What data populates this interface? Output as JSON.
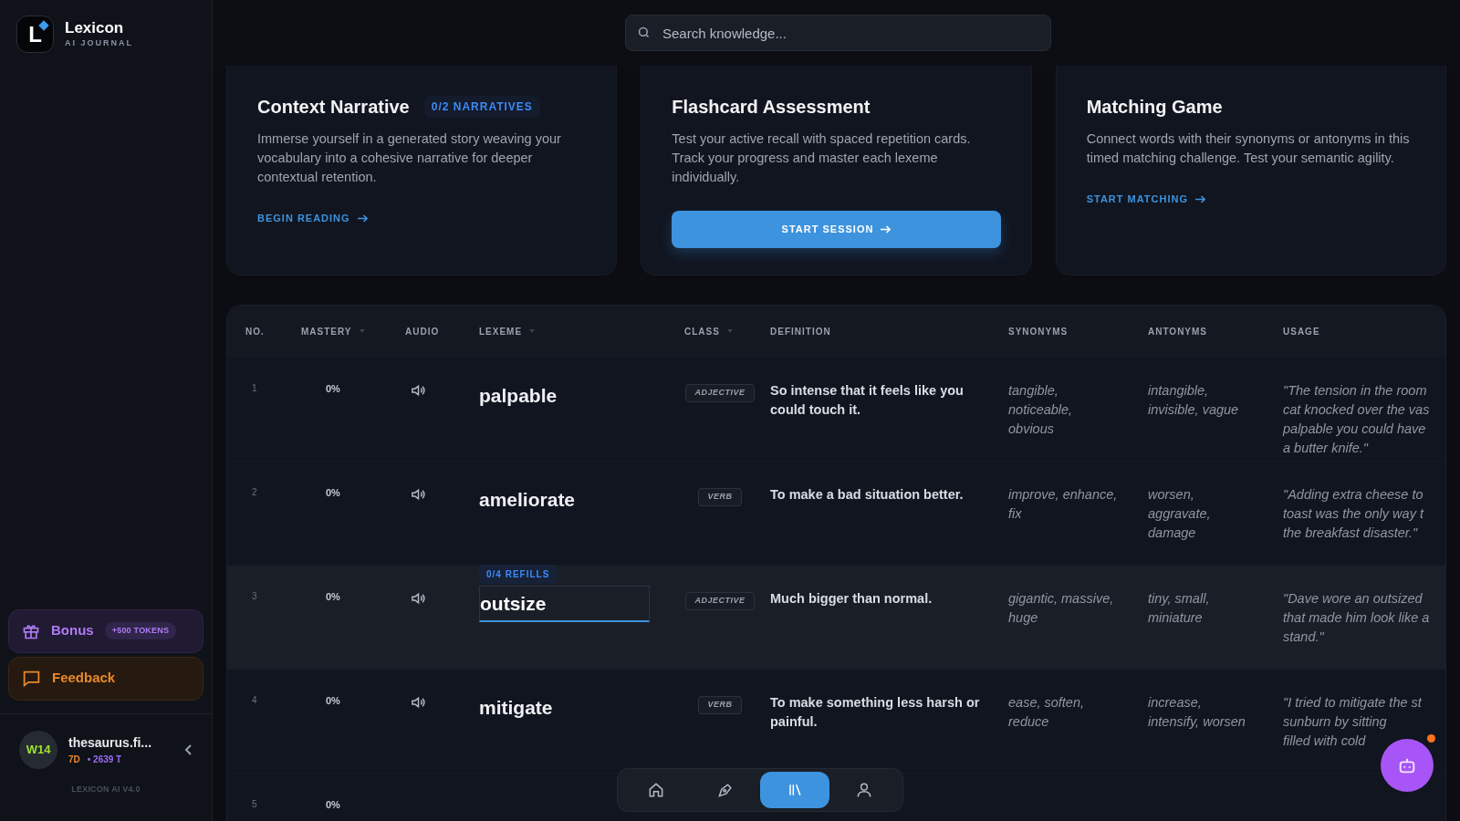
{
  "brand": {
    "logo_letter": "L",
    "name": "Lexicon",
    "tagline": "AI JOURNAL"
  },
  "sidebar": {
    "bonus": {
      "label": "Bonus",
      "badge": "+500 TOKENS"
    },
    "feedback": {
      "label": "Feedback"
    },
    "user": {
      "avatar": "W14",
      "name": "thesaurus.fi...",
      "streak": "7D",
      "tokens": "• 2639 T"
    },
    "version": "LEXICON AI V4.0"
  },
  "search": {
    "placeholder": "Search knowledge..."
  },
  "cards": [
    {
      "kind": "link",
      "title": "Context Narrative",
      "badge": "0/2 NARRATIVES",
      "text": "Immerse yourself in a generated story weaving your vocabulary into a cohesive narrative for deeper contextual retention.",
      "action": "BEGIN READING"
    },
    {
      "kind": "button",
      "title": "Flashcard Assessment",
      "text": "Test your active recall with spaced repetition cards. Track your progress and master each lexeme individually.",
      "action": "START SESSION"
    },
    {
      "kind": "link",
      "title": "Matching Game",
      "text": "Connect words with their synonyms or antonyms in this timed matching challenge. Test your semantic agility.",
      "action": "START MATCHING"
    }
  ],
  "table": {
    "columns": [
      {
        "label": "NO.",
        "sortable": false
      },
      {
        "label": "MASTERY",
        "sortable": true
      },
      {
        "label": "AUDIO",
        "sortable": false
      },
      {
        "label": "LEXEME",
        "sortable": true
      },
      {
        "label": "CLASS",
        "sortable": true
      },
      {
        "label": "DEFINITION",
        "sortable": false
      },
      {
        "label": "SYNONYMS",
        "sortable": false
      },
      {
        "label": "ANTONYMS",
        "sortable": false
      },
      {
        "label": "USAGE",
        "sortable": false
      }
    ],
    "rows": [
      {
        "no": "1",
        "mastery": "0%",
        "lexeme": "palpable",
        "editing": false,
        "class": "ADJECTIVE",
        "definition": "So intense that it feels like you could touch it.",
        "synonyms": "tangible, noticeable, obvious",
        "antonyms": "intangible, invisible, vague",
        "usage": [
          "\"The tension in the room",
          "cat knocked over the vas",
          "palpable you could have",
          "a butter knife.\""
        ]
      },
      {
        "no": "2",
        "mastery": "0%",
        "lexeme": "ameliorate",
        "editing": false,
        "class": "VERB",
        "definition": "To make a bad situation better.",
        "synonyms": "improve, enhance, fix",
        "antonyms": "worsen, aggravate, damage",
        "usage": [
          "\"Adding extra cheese to",
          "toast was the only way t",
          "the breakfast disaster.\""
        ]
      },
      {
        "no": "3",
        "mastery": "0%",
        "lexeme": "outsize",
        "editing": true,
        "refills": "0/4 REFILLS",
        "class": "ADJECTIVE",
        "definition": "Much bigger than normal.",
        "synonyms": "gigantic, massive, huge",
        "antonyms": "tiny, small, miniature",
        "usage": [
          "\"Dave wore an outsized",
          "that made him look like a",
          "stand.\""
        ]
      },
      {
        "no": "4",
        "mastery": "0%",
        "lexeme": "mitigate",
        "editing": false,
        "class": "VERB",
        "definition": "To make something less harsh or painful.",
        "synonyms": "ease, soften, reduce",
        "antonyms": "increase, intensify, worsen",
        "usage": [
          "\"I tried to mitigate the st",
          "sunburn by sitting",
          "filled with cold"
        ]
      },
      {
        "no": "5",
        "mastery": "0%"
      }
    ]
  },
  "bottom_nav": [
    {
      "selected": false
    },
    {
      "selected": false
    },
    {
      "selected": true
    },
    {
      "selected": false
    }
  ]
}
